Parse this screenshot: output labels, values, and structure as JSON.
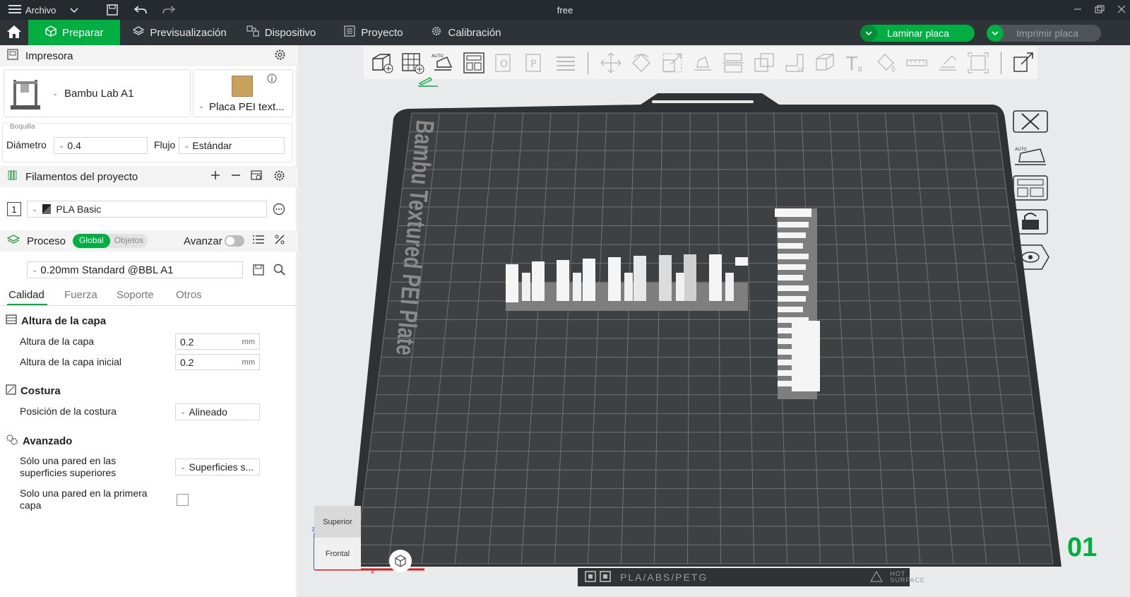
{
  "app": {
    "menu_label": "Archivo",
    "window_title": "free"
  },
  "nav": {
    "tabs": [
      "Preparar",
      "Previsualización",
      "Dispositivo",
      "Proyecto",
      "Calibración"
    ],
    "slice_button": "Laminar placa",
    "print_button": "Imprimir placa"
  },
  "printer": {
    "section_title": "Impresora",
    "model": "Bambu Lab A1",
    "plate": "Placa PEI text...",
    "nozzle_group": "Boquilla",
    "diameter_label": "Diámetro",
    "diameter_value": "0.4",
    "flow_label": "Flujo",
    "flow_value": "Estándar"
  },
  "filaments": {
    "section_title": "Filamentos del proyecto",
    "items": [
      {
        "index": "1",
        "name": "PLA Basic"
      }
    ]
  },
  "process": {
    "section_title": "Proceso",
    "toggle_global": "Global",
    "toggle_objects": "Objetos",
    "advance_label": "Avanzar",
    "preset": "0.20mm Standard @BBL A1",
    "tabs": [
      "Calidad",
      "Fuerza",
      "Soporte",
      "Otros"
    ],
    "active_tab": "Calidad",
    "groups": {
      "layer_height": {
        "title": "Altura de la capa",
        "layer_height_label": "Altura de la capa",
        "layer_height_value": "0.2",
        "initial_layer_label": "Altura de la capa inicial",
        "initial_layer_value": "0.2",
        "unit": "mm"
      },
      "seam": {
        "title": "Costura",
        "position_label": "Posición de la costura",
        "position_value": "Alineado"
      },
      "advanced": {
        "title": "Avanzado",
        "top_one_wall_label": "Sólo una pared en las superficies superiores",
        "top_one_wall_value": "Superficies s...",
        "first_layer_one_wall_label": "Solo una pared en la primera capa",
        "first_layer_one_wall_checked": false
      }
    }
  },
  "viewport": {
    "plate_name": "Bambu Textured PEI Plate",
    "plate_number": "01",
    "bottom_strip": "PLA/ABS/PETG",
    "hot_surface": "HOT SURFACE",
    "view_top": "Superior",
    "view_front": "Frontal",
    "axis_z": "z",
    "axis_x": "x"
  },
  "colors": {
    "accent": "#00ae42",
    "titlebar": "#242a2e",
    "toolbar": "#2d3337",
    "bed": "#3e4144",
    "grid": "#6f7376"
  }
}
